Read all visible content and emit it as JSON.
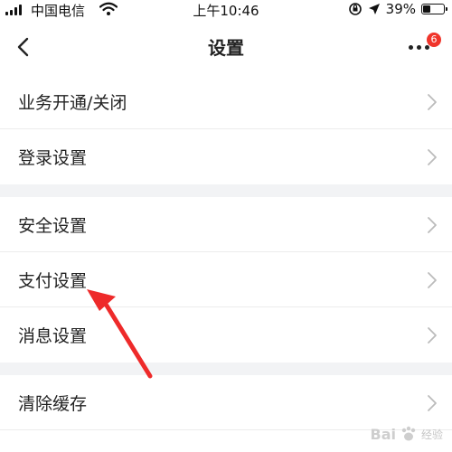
{
  "status_bar": {
    "carrier": "中国电信",
    "time": "上午10:46",
    "battery_percent": "39%",
    "battery_level": 0.39,
    "icons": [
      "signal-icon",
      "wifi-icon",
      "orientation-lock-icon",
      "location-icon",
      "battery-icon"
    ]
  },
  "nav": {
    "title": "设置",
    "back_icon": "chevron-left-icon",
    "more_icon": "more-dots-icon",
    "badge_count": "6"
  },
  "settings_groups": [
    [
      {
        "label": "业务开通/关闭"
      },
      {
        "label": "登录设置"
      }
    ],
    [
      {
        "label": "安全设置"
      },
      {
        "label": "支付设置"
      },
      {
        "label": "消息设置"
      }
    ],
    [
      {
        "label": "清除缓存"
      }
    ]
  ],
  "watermark": {
    "brand": "Bai",
    "sub": "经验"
  },
  "colors": {
    "accent_red": "#f0352b",
    "separator": "#ececec",
    "group_gap": "#f2f3f5",
    "chevron": "#bbbbbb"
  }
}
